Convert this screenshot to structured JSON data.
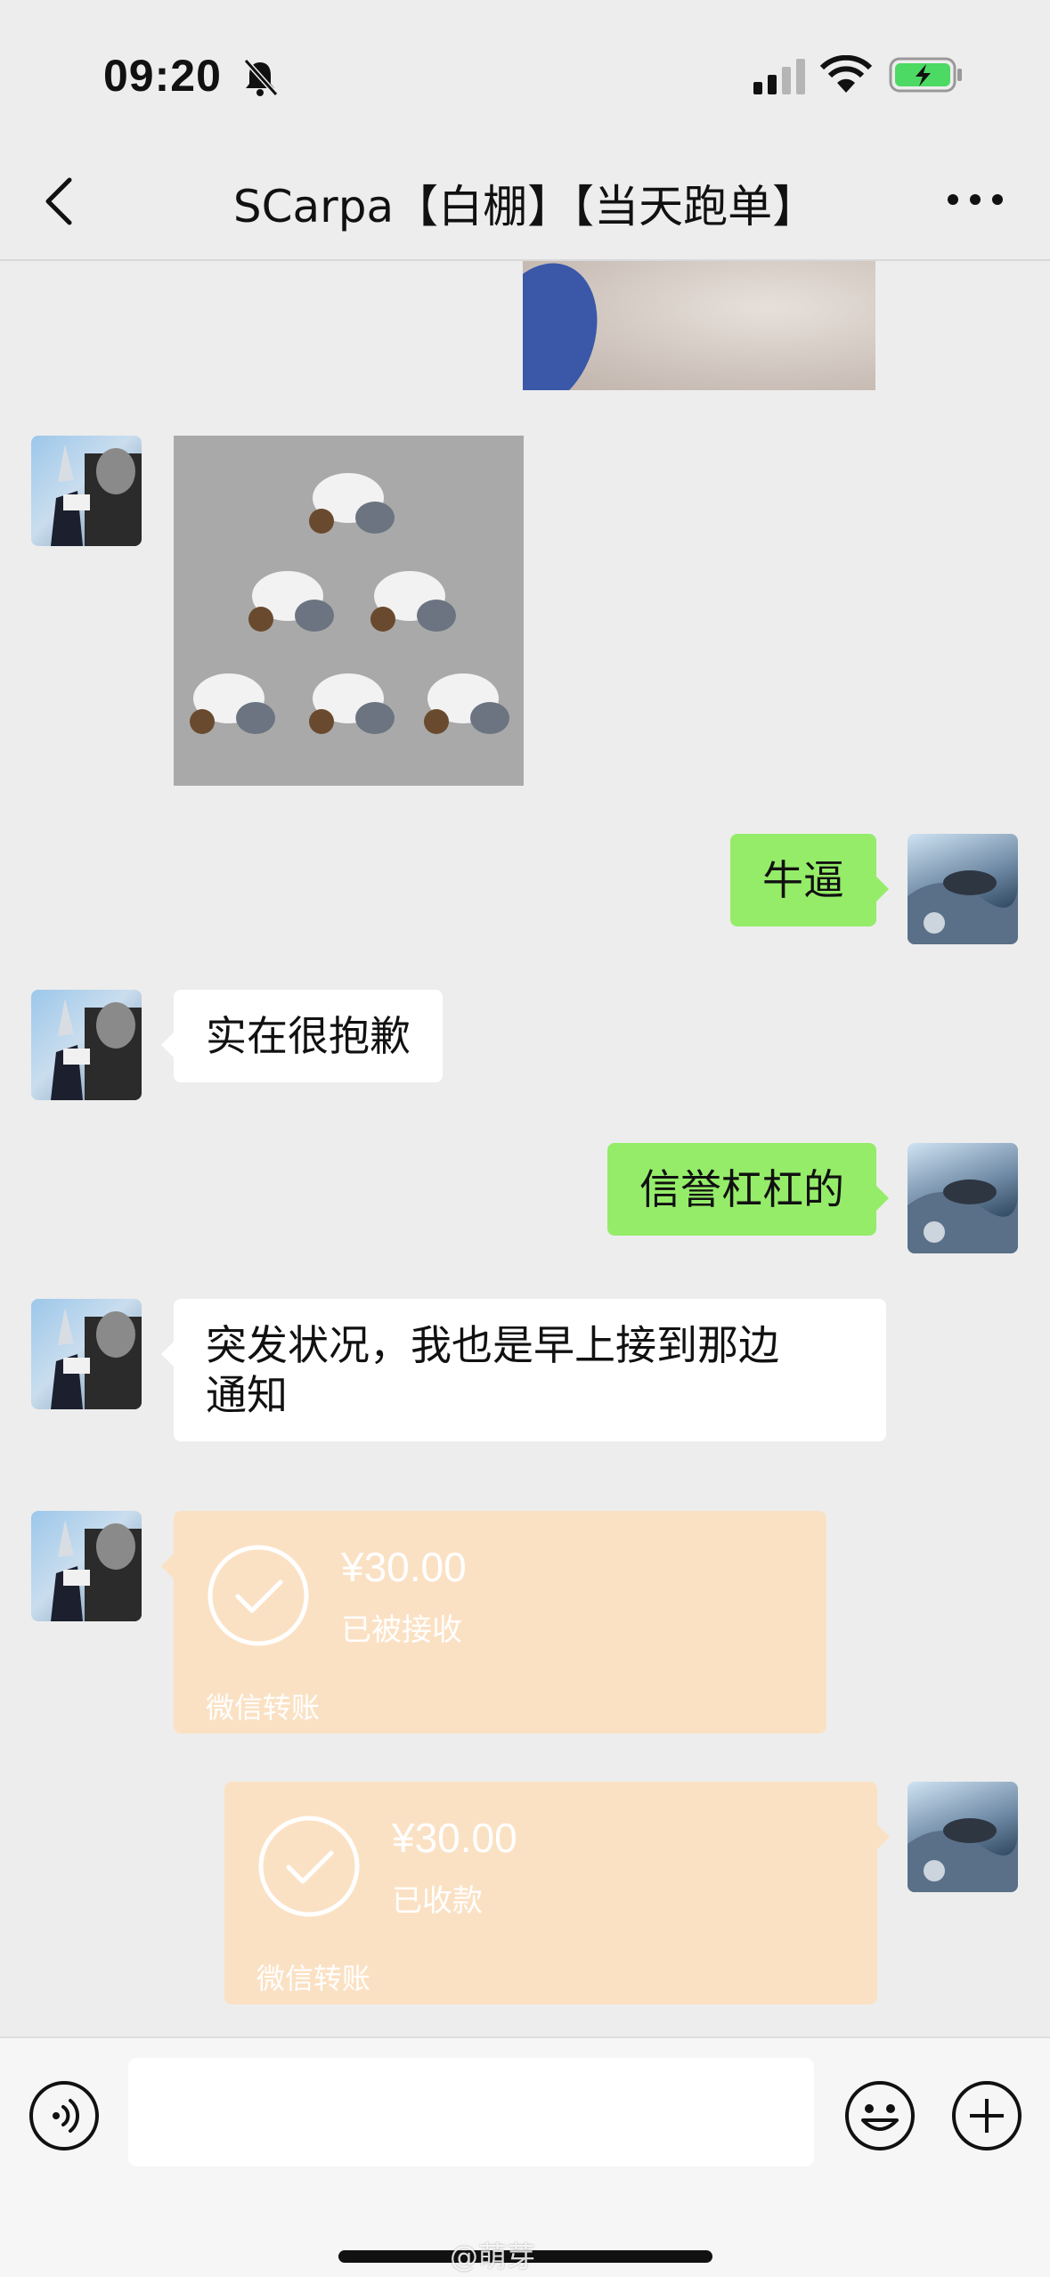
{
  "status_bar": {
    "time": "09:20"
  },
  "header": {
    "title": "SCarpa【白棚】【当天跑单】"
  },
  "messages": {
    "m1": "牛逼",
    "m2": "实在很抱歉",
    "m3": "信誉杠杠的",
    "m4_line1": "突发状况，我也是早上接到那边",
    "m4_line2": "通知",
    "transfer1": {
      "amount": "¥30.00",
      "status": "已被接收",
      "label": "微信转账"
    },
    "transfer2": {
      "amount": "¥30.00",
      "status": "已收款",
      "label": "微信转账"
    }
  },
  "watermark": "@萌芽",
  "colors": {
    "background": "#ededed",
    "my_bubble": "#95ec69",
    "their_bubble": "#ffffff",
    "transfer_card": "#fbe1c4",
    "battery_fill": "#4cd964"
  },
  "icons": [
    "back-icon",
    "bell-muted-icon",
    "signal-icon",
    "wifi-icon",
    "battery-charging-icon",
    "more-icon",
    "voice-icon",
    "emoji-icon",
    "plus-icon",
    "check-circle-icon"
  ]
}
